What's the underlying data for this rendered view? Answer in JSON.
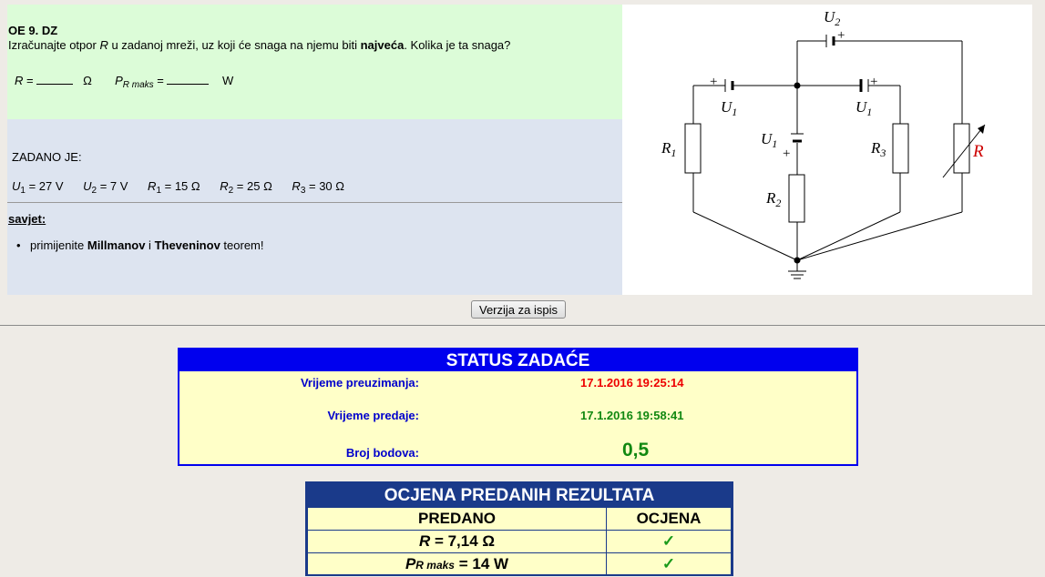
{
  "task": {
    "title": "OE 9. DZ",
    "question_pre": "Izračunajte otpor ",
    "question_var": "R",
    "question_mid": " u zadanoj mreži, uz koji će snaga na njemu biti ",
    "question_bold": "najveća",
    "question_post": ". Kolika je ta snaga?",
    "answer_r_label": "R",
    "answer_r_eq": " = ",
    "answer_r_unit": "Ω",
    "answer_p_label": "P",
    "answer_p_sub": "R maks",
    "answer_p_eq": " = ",
    "answer_p_unit": "W"
  },
  "given": {
    "label": "ZADANO JE:",
    "values": [
      {
        "sym": "U",
        "sub": "1",
        "text": " = 27 V"
      },
      {
        "sym": "U",
        "sub": "2",
        "text": " = 7 V"
      },
      {
        "sym": "R",
        "sub": "1",
        "text": " = 15 Ω"
      },
      {
        "sym": "R",
        "sub": "2",
        "text": " = 25 Ω"
      },
      {
        "sym": "R",
        "sub": "3",
        "text": " = 30 Ω"
      }
    ]
  },
  "hint": {
    "title": "savjet:",
    "pre": "primijenite ",
    "bold1": "Millmanov",
    "mid": " i ",
    "bold2": "Theveninov",
    "post": " teorem!"
  },
  "circuit": {
    "labels": {
      "u2": "U",
      "u2_sub": "2",
      "u1_left": "U",
      "u1_left_sub": "1",
      "u1_mid": "U",
      "u1_mid_sub": "1",
      "u1_right": "U",
      "u1_right_sub": "1",
      "r1": "R",
      "r1_sub": "1",
      "r2": "R",
      "r2_sub": "2",
      "r3": "R",
      "r3_sub": "3",
      "r": "R",
      "plus": "+"
    }
  },
  "print_button": "Verzija za ispis",
  "status": {
    "header": "STATUS ZADAĆE",
    "rows": [
      {
        "label": "Vrijeme preuzimanja:",
        "value": "17.1.2016 19:25:14",
        "color": "#ee0000"
      },
      {
        "label": "Vrijeme predaje:",
        "value": "17.1.2016 19:58:41",
        "color": "#118811"
      },
      {
        "label": "Broj bodova:",
        "value": "0,5",
        "color": "#118811"
      }
    ]
  },
  "evaluation": {
    "header": "OCJENA PREDANIH REZULTATA",
    "col_submitted": "PREDANO",
    "col_grade": "OCJENA",
    "rows": [
      {
        "sym": "R",
        "sub": "",
        "text": " = 7,14 Ω",
        "grade": "✓"
      },
      {
        "sym": "P",
        "sub": "R maks",
        "text": " = 14 W",
        "grade": "✓"
      }
    ]
  }
}
